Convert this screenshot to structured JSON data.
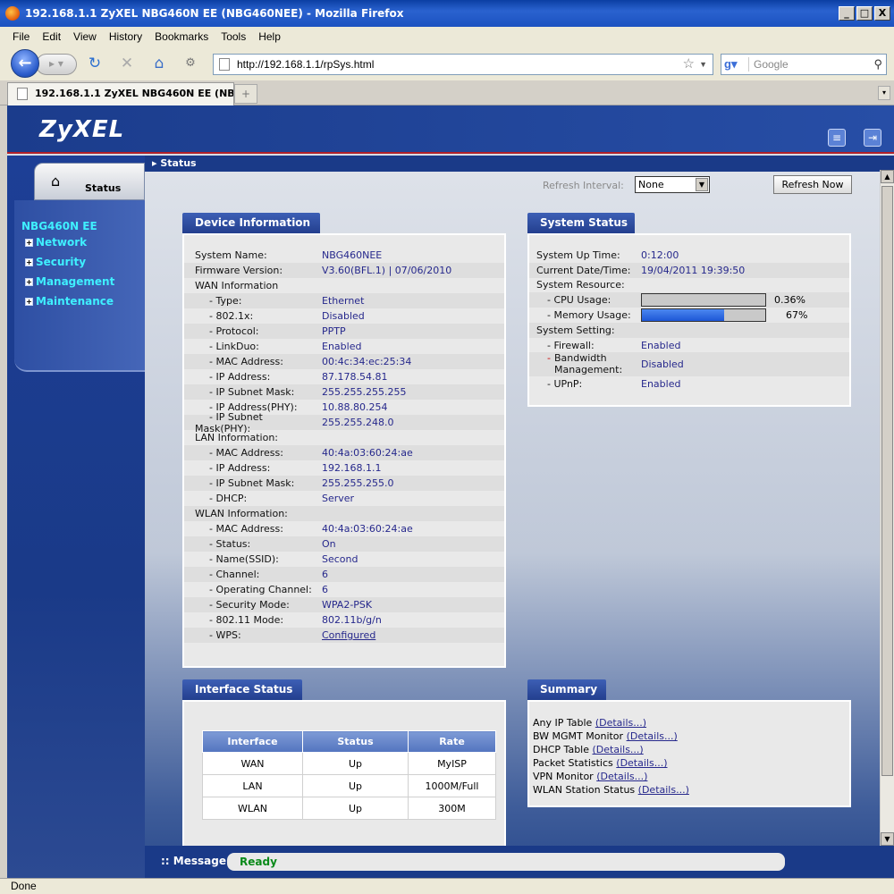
{
  "window": {
    "title": "192.168.1.1 ZyXEL NBG460N EE (NBG460NEE) - Mozilla Firefox",
    "min": "_",
    "max": "□",
    "close": "X"
  },
  "menu": [
    "File",
    "Edit",
    "View",
    "History",
    "Bookmarks",
    "Tools",
    "Help"
  ],
  "nav": {
    "url": "http://192.168.1.1/rpSys.html",
    "search_placeholder": "Google"
  },
  "tab": {
    "label": "192.168.1.1 ZyXEL NBG460N EE (NBG4...",
    "new_tab": "+"
  },
  "header": {
    "logo": "ZyXEL"
  },
  "sidebar": {
    "status_label": "Status",
    "device_name": "NBG460N EE",
    "items": [
      "Network",
      "Security",
      "Management",
      "Maintenance"
    ]
  },
  "breadcrumb": "Status",
  "refresh": {
    "label": "Refresh Interval:",
    "value": "None",
    "button": "Refresh Now"
  },
  "device_info": {
    "title": "Device Information",
    "rows": [
      {
        "k": "System Name:",
        "v": "NBG460NEE"
      },
      {
        "k": "Firmware Version:",
        "v": "V3.60(BFL.1) | 07/06/2010"
      },
      {
        "k": "WAN Information",
        "v": ""
      },
      {
        "k": "- Type:",
        "v": "Ethernet"
      },
      {
        "k": "- 802.1x:",
        "v": "Disabled"
      },
      {
        "k": "- Protocol:",
        "v": "PPTP"
      },
      {
        "k": "- LinkDuo:",
        "v": "Enabled"
      },
      {
        "k": "- MAC Address:",
        "v": "00:4c:34:ec:25:34"
      },
      {
        "k": "- IP Address:",
        "v": "87.178.54.81"
      },
      {
        "k": "- IP Subnet Mask:",
        "v": "255.255.255.255"
      },
      {
        "k": "- IP Address(PHY):",
        "v": "10.88.80.254"
      },
      {
        "k": "- IP Subnet",
        "k2": "Mask(PHY):",
        "v": "255.255.248.0"
      },
      {
        "k": "LAN Information:",
        "v": ""
      },
      {
        "k": "- MAC Address:",
        "v": "40:4a:03:60:24:ae"
      },
      {
        "k": "- IP Address:",
        "v": "192.168.1.1"
      },
      {
        "k": "- IP Subnet Mask:",
        "v": "255.255.255.0"
      },
      {
        "k": "- DHCP:",
        "v": "Server"
      },
      {
        "k": "WLAN Information:",
        "v": ""
      },
      {
        "k": "- MAC Address:",
        "v": "40:4a:03:60:24:ae"
      },
      {
        "k": "- Status:",
        "v": "On"
      },
      {
        "k": "- Name(SSID):",
        "v": "Second"
      },
      {
        "k": "- Channel:",
        "v": "6"
      },
      {
        "k": "- Operating Channel:",
        "v": "6"
      },
      {
        "k": "- Security Mode:",
        "v": "WPA2-PSK"
      },
      {
        "k": "- 802.11 Mode:",
        "v": "802.11b/g/n"
      },
      {
        "k": "- WPS:",
        "v": "Configured"
      }
    ]
  },
  "system_status": {
    "title": "System Status",
    "uptime_label": "System Up Time:",
    "uptime": "0:12:00",
    "datetime_label": "Current Date/Time:",
    "datetime": "19/04/2011 19:39:50",
    "resource_label": "System Resource:",
    "cpu_label": "- CPU Usage:",
    "cpu": "0.36%",
    "cpu_fraction": 0.0036,
    "mem_label": "- Memory Usage:",
    "mem": "67%",
    "mem_fraction": 0.67,
    "setting_label": "System Setting:",
    "firewall_label": "- Firewall:",
    "firewall": "Enabled",
    "bw_label_1": "Bandwidth",
    "bw_label_2": "Management:",
    "bw_dash": "-",
    "bw": "Disabled",
    "upnp_label": "- UPnP:",
    "upnp": "Enabled"
  },
  "interface_status": {
    "title": "Interface Status",
    "headers": [
      "Interface",
      "Status",
      "Rate"
    ],
    "rows": [
      [
        "WAN",
        "Up",
        "MyISP"
      ],
      [
        "LAN",
        "Up",
        "1000M/Full"
      ],
      [
        "WLAN",
        "Up",
        "300M"
      ]
    ]
  },
  "summary": {
    "title": "Summary",
    "rows": [
      {
        "label": "Any IP Table",
        "link": "(Details...)"
      },
      {
        "label": "BW MGMT Monitor",
        "link": "(Details...)"
      },
      {
        "label": "DHCP Table",
        "link": "(Details...)"
      },
      {
        "label": "Packet Statistics",
        "link": "(Details...)"
      },
      {
        "label": "VPN Monitor",
        "link": "(Details...)"
      },
      {
        "label": "WLAN Station Status",
        "link": "(Details...)"
      }
    ]
  },
  "message": {
    "label": "Message",
    "text": "Ready"
  },
  "statusbar": "Done"
}
